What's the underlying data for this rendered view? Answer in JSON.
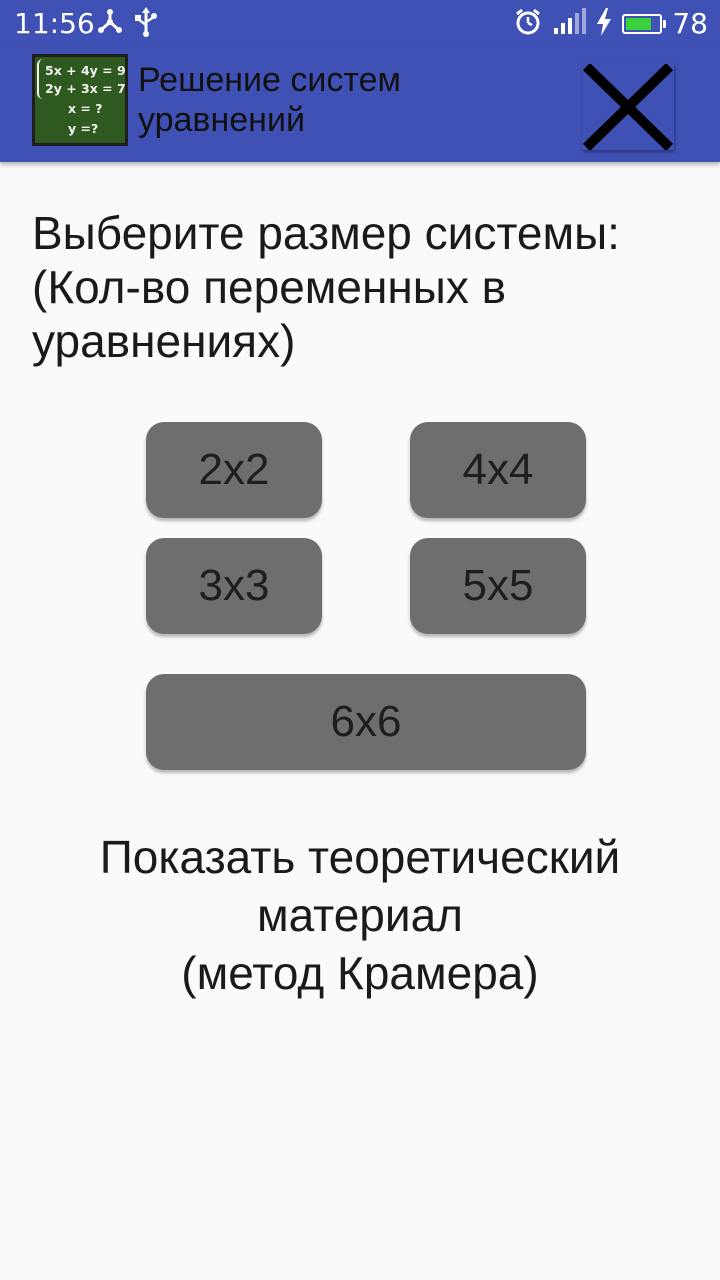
{
  "status_bar": {
    "time": "11:56",
    "battery_level": "78",
    "icons": [
      "nodes-icon",
      "usb-icon",
      "alarm-icon",
      "signal-icon",
      "charging-icon",
      "battery-icon"
    ],
    "battery_fill_fraction": 0.78,
    "battery_color": "#3ad13a"
  },
  "app_bar": {
    "title_line1": "Решение систем",
    "title_line2": "уравнений",
    "logo": {
      "line1": "5x + 4y = 9",
      "line2": "2y + 3x = 7",
      "line3": "x = ?",
      "line4": "y =?"
    },
    "close_icon": "close-icon",
    "color": "#3f51b5"
  },
  "main": {
    "prompt_line1": "Выберите размер системы:",
    "prompt_line2": "(Кол-во переменных в",
    "prompt_line3": "уравнениях)",
    "buttons": [
      {
        "label": "2x2"
      },
      {
        "label": "4x4"
      },
      {
        "label": "3x3"
      },
      {
        "label": "5x5"
      },
      {
        "label": "6x6"
      }
    ],
    "theory_line1": "Показать теоретический",
    "theory_line2": "материал",
    "theory_line3": "(метод Крамера)"
  }
}
